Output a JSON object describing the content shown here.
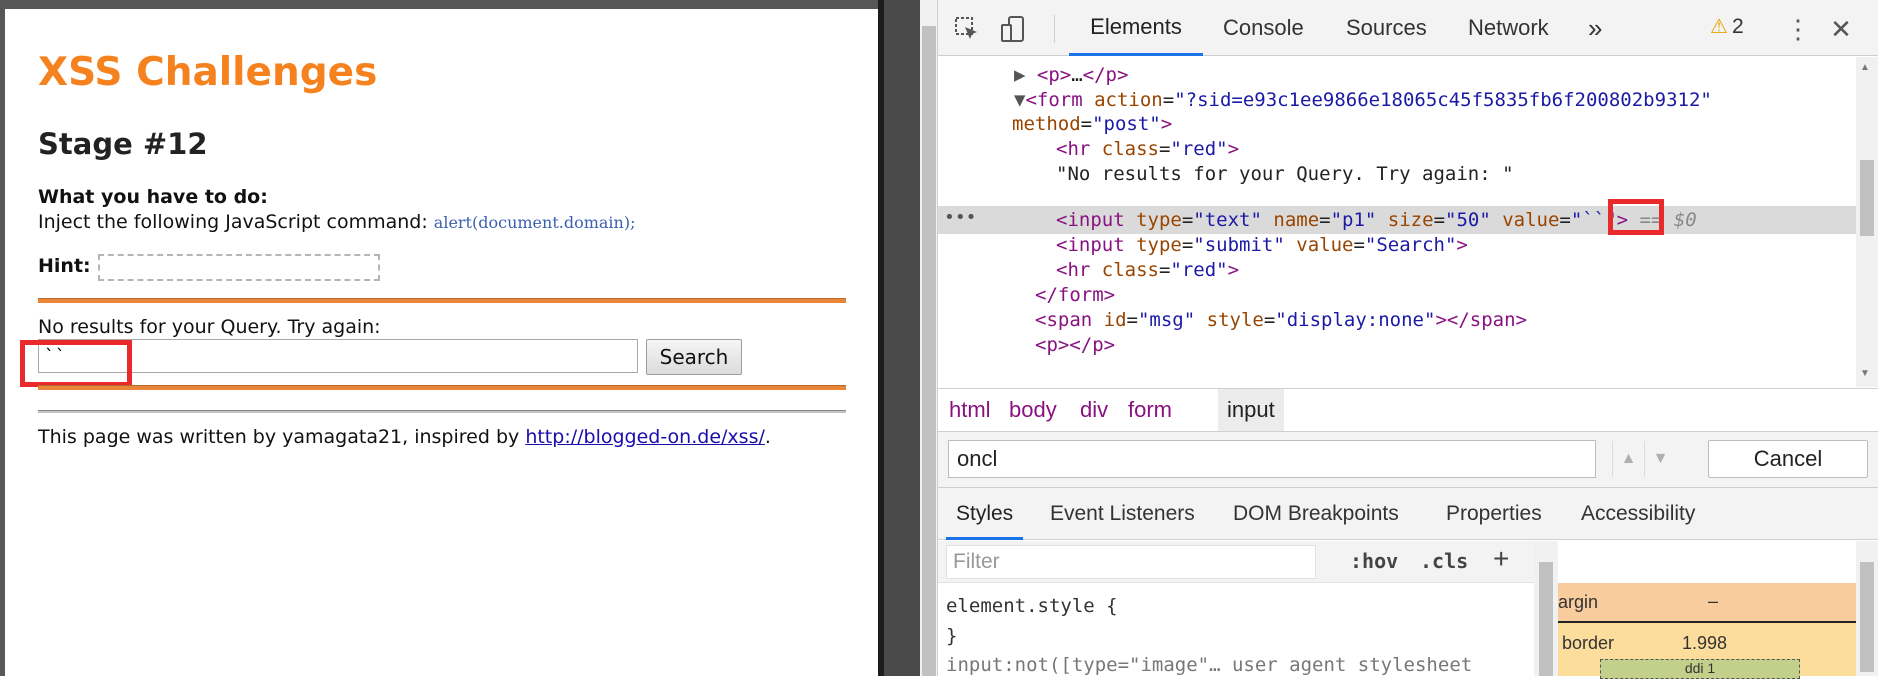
{
  "page": {
    "title": "XSS Challenges",
    "stage": "Stage #12",
    "task_heading": "What you have to do:",
    "task_text": "Inject the following JavaScript command: ",
    "task_code": "alert(document.domain);",
    "hint_label": "Hint:",
    "result_text": "No results for your Query. Try again:",
    "query_value": "``",
    "search_label": "Search",
    "footer_prefix": "This page was written by yamagata21, inspired by ",
    "footer_link": "http://blogged-on.de/xss/",
    "footer_suffix": "."
  },
  "devtools": {
    "tabs": [
      "Elements",
      "Console",
      "Sources",
      "Network"
    ],
    "more_tabs": "»",
    "warning_count": "2",
    "tree": {
      "p_collapsed": {
        "tag_open": "<p>",
        "ellipsis": "…",
        "tag_close": "</p>"
      },
      "form_tag": "<form",
      "form_action_attr": " action",
      "form_action_val": "\"?sid=e93c1ee9866e18065c45f5835fb6f200802b9312\"",
      "form_method_attr": "method",
      "form_method_val": "\"post\"",
      "hr1_tag": "<hr",
      "hr_class_attr": " class",
      "hr_class_val": "\"red\"",
      "text_node": "\"No results for your Query. Try again: \"",
      "input1_tag": "<input",
      "input1_type_attr": " type",
      "input1_type_val": "\"text\"",
      "input1_name_attr": " name",
      "input1_name_val": "\"p1\"",
      "input1_size_attr": " size",
      "input1_size_val": "\"50\"",
      "input1_value_attr": " value",
      "input1_value_val": "\"``\"",
      "selected_marker": " == $0",
      "input2_tag": "<input",
      "input2_type_attr": " type",
      "input2_type_val": "\"submit\"",
      "input2_value_attr": " value",
      "input2_value_val": "\"Search\"",
      "hr2_tag": "<hr",
      "form_close": "</form>",
      "span_tag": "<span",
      "span_id_attr": " id",
      "span_id_val": "\"msg\"",
      "span_style_attr": " style",
      "span_style_val": "\"display:none\"",
      "span_close": "></span>",
      "p_empty": "<p></p>",
      "close_bracket": ">"
    },
    "breadcrumbs": [
      "html",
      "body",
      "div",
      "form",
      "input"
    ],
    "search_value": "oncl",
    "cancel_label": "Cancel",
    "style_tabs": [
      "Styles",
      "Event Listeners",
      "DOM Breakpoints",
      "Properties",
      "Accessibility"
    ],
    "filter_placeholder": "Filter",
    "hov_label": ":hov",
    "cls_label": ".cls",
    "add_label": "+",
    "css": {
      "element_style": "element.style {",
      "close_brace": "}",
      "next_rule": "input:not([type=\"image\"…   user agent stylesheet"
    },
    "box_model": {
      "margin_label": "argin",
      "margin_value": "–",
      "border_label": "border",
      "border_value": "1.998",
      "padding_label": "ddi   1"
    }
  },
  "colors": {
    "title_orange": "#f6821f",
    "highlight_red": "#ea2a2a",
    "devtools_accent": "#1a73e8"
  }
}
